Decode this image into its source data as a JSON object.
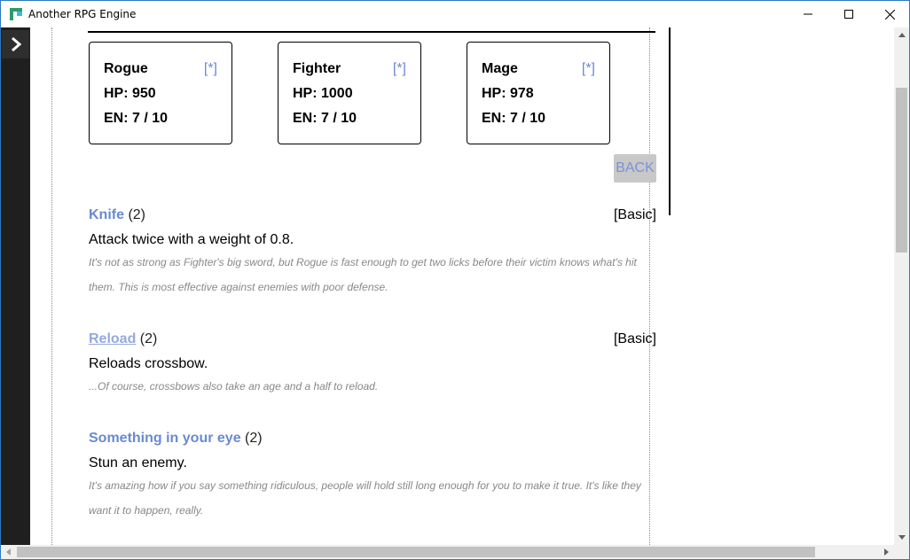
{
  "window": {
    "title": "Another RPG Engine"
  },
  "party": [
    {
      "name": "Rogue",
      "hp": "HP: 950",
      "en": "EN: 7 / 10",
      "link": "[*]"
    },
    {
      "name": "Fighter",
      "hp": "HP: 1000",
      "en": "EN: 7 / 10",
      "link": "[*]"
    },
    {
      "name": "Mage",
      "hp": "HP: 978",
      "en": "EN: 7 / 10",
      "link": "[*]"
    }
  ],
  "back_label": "BACK",
  "skills": [
    {
      "name": "Knife",
      "count": "(2)",
      "tag": "[Basic]",
      "description": "Attack twice with a weight of 0.8.",
      "flavor": "It's not as strong as Fighter's big sword, but Rogue is fast enough to get two licks before their victim knows what's hit them. This is most effective against enemies with poor defense."
    },
    {
      "name": "Reload",
      "count": "(2)",
      "tag": "[Basic]",
      "description": "Reloads crossbow.",
      "flavor": "...Of course, crossbows also take an age and a half to reload."
    },
    {
      "name": "Something in your eye",
      "count": "(2)",
      "tag": "",
      "description": "Stun an enemy.",
      "flavor": "It's amazing how if you say something ridiculous, people will hold still long enough for you to make it true. It's like they want it to happen, really."
    }
  ],
  "colors": {
    "link": "#6a8ad0",
    "link_hover": "#94a9dc",
    "sidebar": "#1f1f1f",
    "border": "#2b78c2"
  }
}
